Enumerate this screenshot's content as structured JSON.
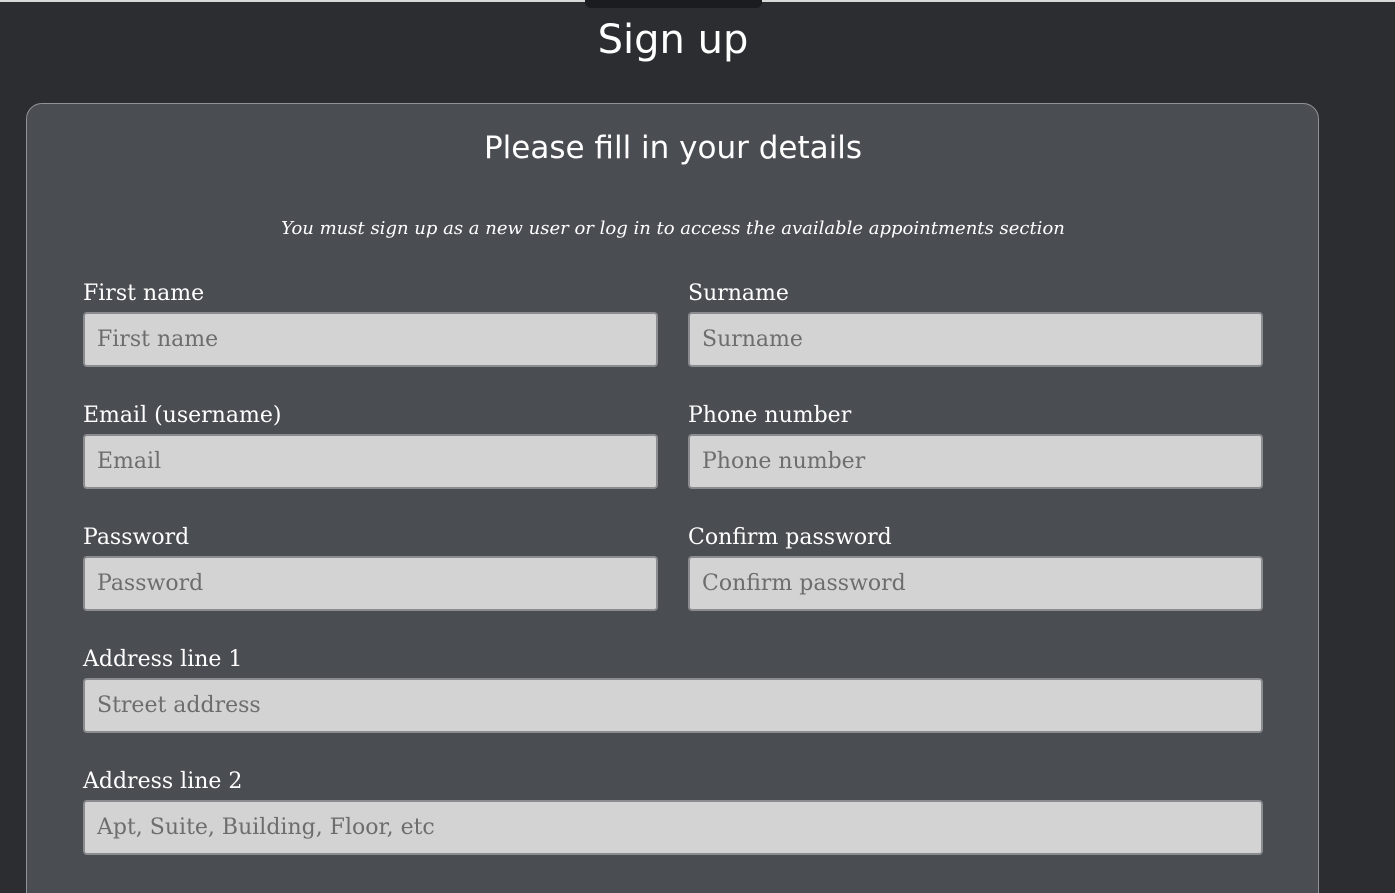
{
  "page": {
    "title": "Sign up"
  },
  "card": {
    "title": "Please fill in your details",
    "note": "You must sign up as a new user or log in to access the available appointments section"
  },
  "fields": {
    "first_name": {
      "label": "First name",
      "placeholder": "First name"
    },
    "surname": {
      "label": "Surname",
      "placeholder": "Surname"
    },
    "email": {
      "label": "Email (username)",
      "placeholder": "Email"
    },
    "phone": {
      "label": "Phone number",
      "placeholder": "Phone number"
    },
    "password": {
      "label": "Password",
      "placeholder": "Password"
    },
    "confirm_password": {
      "label": "Confirm password",
      "placeholder": "Confirm password"
    },
    "address_line_1": {
      "label": "Address line 1",
      "placeholder": "Street address"
    },
    "address_line_2": {
      "label": "Address line 2",
      "placeholder": "Apt, Suite, Building, Floor, etc"
    }
  },
  "colors": {
    "page_background": "#2c2d31",
    "card_background": "#4a4d52",
    "input_background": "#d3d3d3",
    "text": "#ffffff"
  }
}
